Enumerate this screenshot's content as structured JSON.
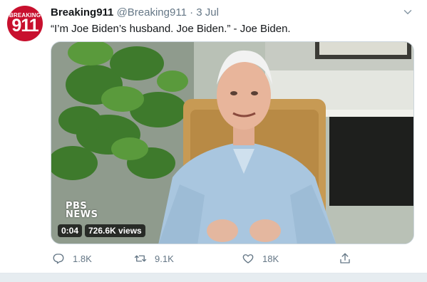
{
  "tweet": {
    "display_name": "Breaking911",
    "handle": "@Breaking911",
    "separator": "·",
    "date": "3 Jul",
    "text": "“I’m Joe Biden’s husband. Joe Biden.” - Joe Biden.",
    "avatar": {
      "top_text": "BREAKING",
      "main_text": "911",
      "color": "#c8102e"
    }
  },
  "media": {
    "watermark_line1": "PBS",
    "watermark_line2": "NEWS",
    "duration": "0:04",
    "views": "726.6K views"
  },
  "actions": {
    "reply": {
      "icon": "reply-icon",
      "count": "1.8K"
    },
    "retweet": {
      "icon": "retweet-icon",
      "count": "9.1K"
    },
    "like": {
      "icon": "heart-icon",
      "count": "18K"
    },
    "share": {
      "icon": "share-icon"
    }
  },
  "colors": {
    "text_primary": "#14171a",
    "text_secondary": "#657786",
    "border": "#e1e8ed"
  }
}
